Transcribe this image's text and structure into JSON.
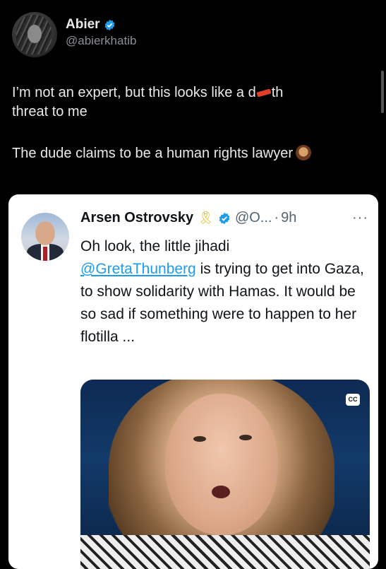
{
  "post": {
    "author_name": "Abier",
    "author_handle": "@abierkhatib",
    "text_line1_before": "I’m not an expert, but this looks like a d",
    "text_line1_after": "th",
    "text_line2": "threat to me",
    "text_para2": "The dude claims to be a human rights lawyer",
    "verified_icon": "verified-badge-icon",
    "emoji_icon": "person-facepalm-icon",
    "redaction_color": "#e0402a"
  },
  "quoted": {
    "author_name": "Arsen Ostrovsky",
    "ribbon": "🎗",
    "handle": "@O...",
    "separator": "·",
    "time": "9h",
    "more": "···",
    "text_before": "Oh look, the little jihadi",
    "mention": "@GretaThunberg",
    "text_after": " is trying to get into Gaza, to show solidarity with Hamas. It would be so sad if something were to happen to her flotilla ...",
    "media_badge": "CC"
  },
  "colors": {
    "background": "#000000",
    "card": "#ffffff",
    "accent": "#1d9bf0"
  }
}
